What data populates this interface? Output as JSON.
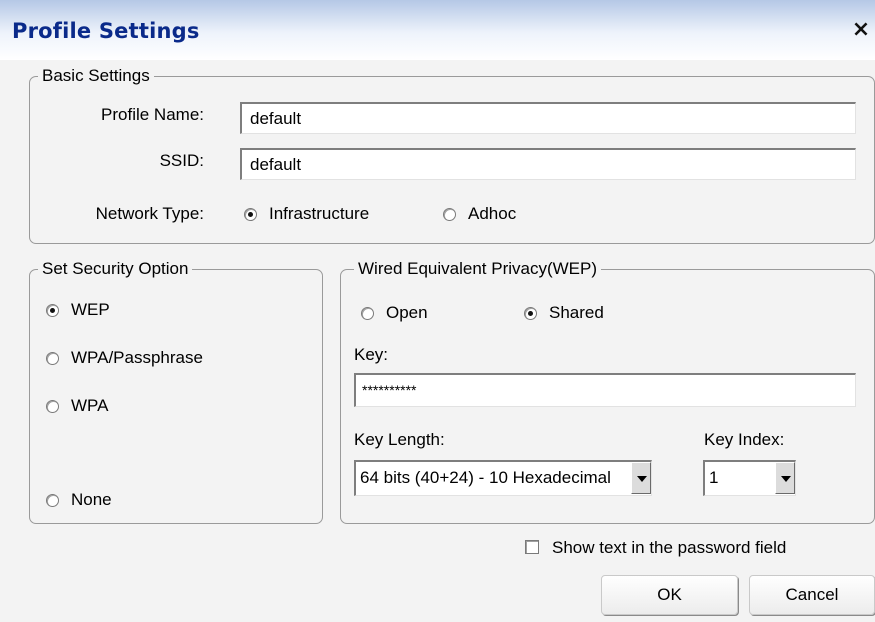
{
  "window": {
    "title": "Profile Settings",
    "close_glyph": "×"
  },
  "basic": {
    "legend": "Basic Settings",
    "profile_name_label": "Profile Name:",
    "profile_name_value": "default",
    "ssid_label": "SSID:",
    "ssid_value": "default",
    "network_type_label": "Network Type:",
    "network_types": [
      {
        "label": "Infrastructure",
        "selected": true
      },
      {
        "label": "Adhoc",
        "selected": false
      }
    ]
  },
  "security": {
    "legend": "Set Security Option",
    "options": [
      {
        "label": "WEP",
        "selected": true
      },
      {
        "label": "WPA/Passphrase",
        "selected": false
      },
      {
        "label": "WPA",
        "selected": false
      },
      {
        "label": "None",
        "selected": false
      }
    ]
  },
  "wep": {
    "legend": "Wired Equivalent Privacy(WEP)",
    "auth": [
      {
        "label": "Open",
        "selected": false
      },
      {
        "label": "Shared",
        "selected": true
      }
    ],
    "key_label": "Key:",
    "key_value": "**********",
    "key_length_label": "Key Length:",
    "key_length_value": "64 bits (40+24) - 10 Hexadecimal",
    "key_index_label": "Key Index:",
    "key_index_value": "1"
  },
  "show_text": {
    "label": "Show text in the password field",
    "checked": false
  },
  "buttons": {
    "ok": "OK",
    "cancel": "Cancel"
  },
  "icons": [
    "close-icon",
    "dropdown-arrow-icon",
    "radio-icon",
    "checkbox-icon"
  ]
}
